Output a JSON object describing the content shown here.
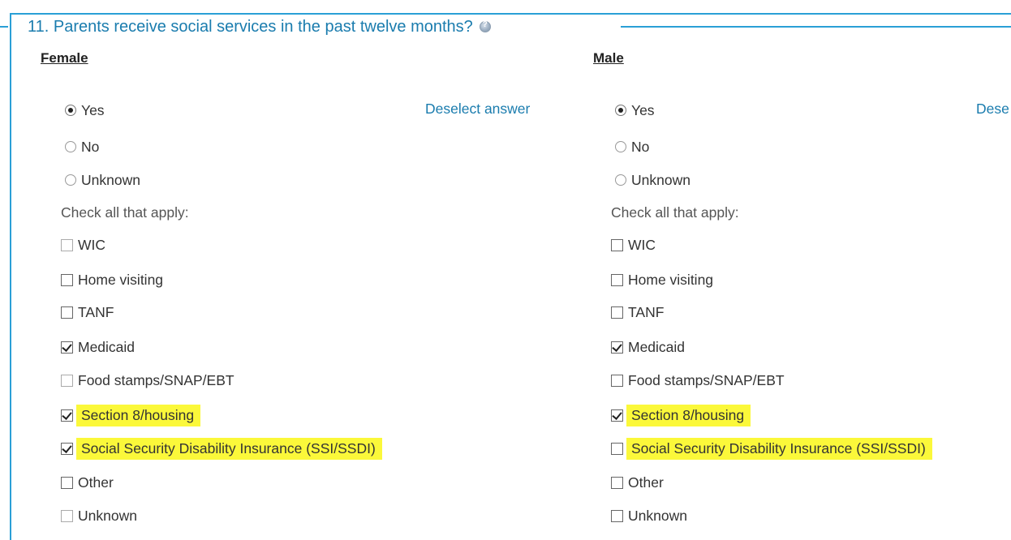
{
  "question": {
    "number_title": "11. Parents receive social services in the past twelve months?",
    "help_icon": "help-icon"
  },
  "columns": [
    {
      "title": "Female",
      "deselect_label": "Deselect answer",
      "radio_options": [
        {
          "label": "Yes",
          "checked": true
        },
        {
          "label": "No",
          "checked": false
        },
        {
          "label": "Unknown",
          "checked": false
        }
      ],
      "check_all_label": "Check all that apply:",
      "checkboxes": [
        {
          "label": "WIC",
          "checked": false,
          "highlighted": false
        },
        {
          "label": "Home visiting",
          "checked": false,
          "highlighted": false
        },
        {
          "label": "TANF",
          "checked": false,
          "highlighted": false
        },
        {
          "label": "Medicaid",
          "checked": true,
          "highlighted": false
        },
        {
          "label": "Food stamps/SNAP/EBT",
          "checked": false,
          "highlighted": false
        },
        {
          "label": "Section 8/housing",
          "checked": true,
          "highlighted": true
        },
        {
          "label": "Social Security Disability Insurance (SSI/SSDI)",
          "checked": true,
          "highlighted": true
        },
        {
          "label": "Other",
          "checked": false,
          "highlighted": false
        },
        {
          "label": "Unknown",
          "checked": false,
          "highlighted": false
        }
      ]
    },
    {
      "title": "Male",
      "deselect_label": "Dese",
      "radio_options": [
        {
          "label": "Yes",
          "checked": true
        },
        {
          "label": "No",
          "checked": false
        },
        {
          "label": "Unknown",
          "checked": false
        }
      ],
      "check_all_label": "Check all that apply:",
      "checkboxes": [
        {
          "label": "WIC",
          "checked": false,
          "highlighted": false
        },
        {
          "label": "Home visiting",
          "checked": false,
          "highlighted": false
        },
        {
          "label": "TANF",
          "checked": false,
          "highlighted": false
        },
        {
          "label": "Medicaid",
          "checked": true,
          "highlighted": false
        },
        {
          "label": "Food stamps/SNAP/EBT",
          "checked": false,
          "highlighted": false
        },
        {
          "label": "Section 8/housing",
          "checked": true,
          "highlighted": true
        },
        {
          "label": "Social Security Disability Insurance (SSI/SSDI)",
          "checked": false,
          "highlighted": true
        },
        {
          "label": "Other",
          "checked": false,
          "highlighted": false
        },
        {
          "label": "Unknown",
          "checked": false,
          "highlighted": false
        }
      ]
    }
  ],
  "colors": {
    "accent": "#2a9fd6",
    "link": "#1a7cae",
    "highlight": "#fbf83a"
  }
}
